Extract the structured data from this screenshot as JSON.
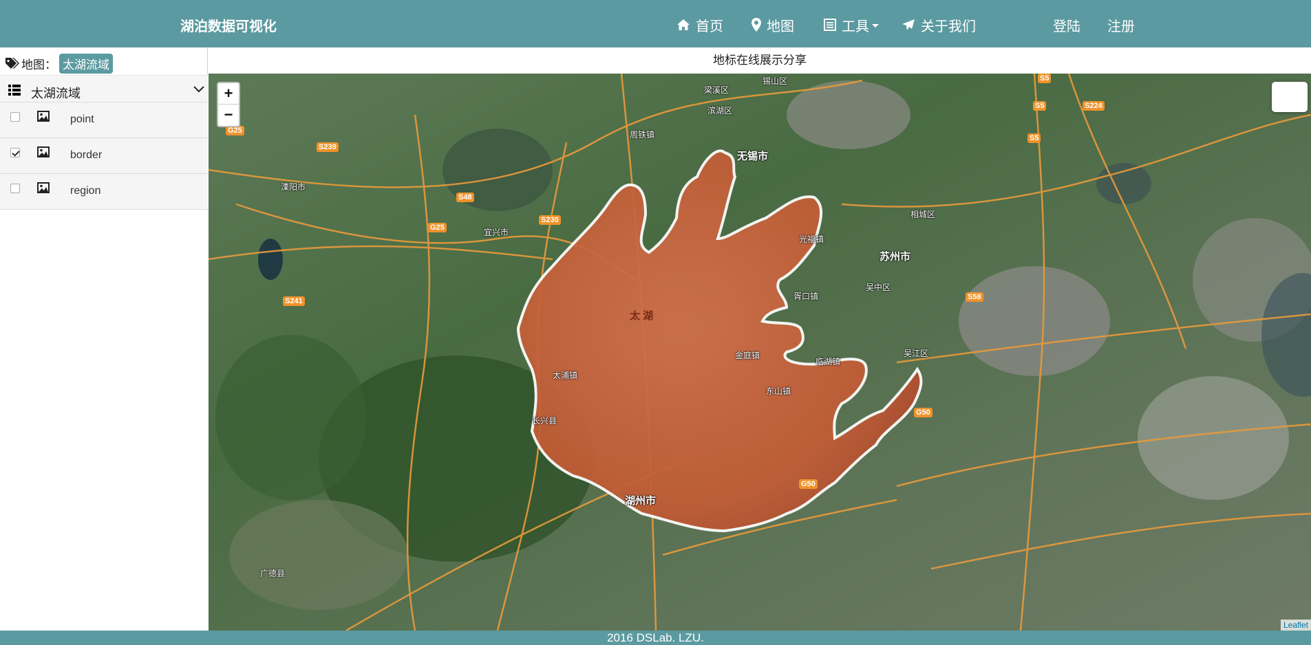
{
  "navbar": {
    "brand": "湖泊数据可视化",
    "items": [
      {
        "label": "首页",
        "icon": "home-icon"
      },
      {
        "label": "地图",
        "icon": "map-marker-icon"
      },
      {
        "label": "工具",
        "icon": "list-alt-icon"
      },
      {
        "label": "关于我们",
        "icon": "send-icon"
      }
    ],
    "login": "登陆",
    "register": "注册"
  },
  "sidebar": {
    "map_prefix": "地图：",
    "map_badge": "太湖流域",
    "group_label": "太湖流域",
    "layers": [
      {
        "name": "point",
        "checked": false
      },
      {
        "name": "border",
        "checked": true
      },
      {
        "name": "region",
        "checked": false
      }
    ]
  },
  "map": {
    "title": "地标在线展示分享",
    "zoom_in": "+",
    "zoom_out": "−",
    "attribution": "Leaflet",
    "lake_label": "太 湖",
    "labels": [
      {
        "text": "无锡市",
        "big": true
      },
      {
        "text": "苏州市",
        "big": true
      },
      {
        "text": "湖州市",
        "big": true
      },
      {
        "text": "宜兴市"
      },
      {
        "text": "长兴县"
      },
      {
        "text": "溧阳市"
      },
      {
        "text": "锡山区"
      },
      {
        "text": "滨湖区"
      },
      {
        "text": "梁溪区"
      },
      {
        "text": "相城区"
      },
      {
        "text": "吴中区"
      },
      {
        "text": "吴江区"
      },
      {
        "text": "金庭镇"
      },
      {
        "text": "东山镇"
      },
      {
        "text": "临湖镇"
      },
      {
        "text": "胥口镇"
      },
      {
        "text": "光福镇"
      },
      {
        "text": "太浦镇"
      },
      {
        "text": "广德县"
      },
      {
        "text": "周铁镇"
      }
    ],
    "shields": [
      "G25",
      "S239",
      "S48",
      "G25",
      "S230",
      "S241",
      "S5",
      "S5",
      "S224",
      "S5",
      "S58",
      "G50",
      "G50"
    ]
  },
  "footer": {
    "text": "2016 DSLab. LZU."
  },
  "colors": {
    "navbar": "#5b9aa0",
    "lake_fill": "#c8643e",
    "lake_border": "#ffffff"
  }
}
